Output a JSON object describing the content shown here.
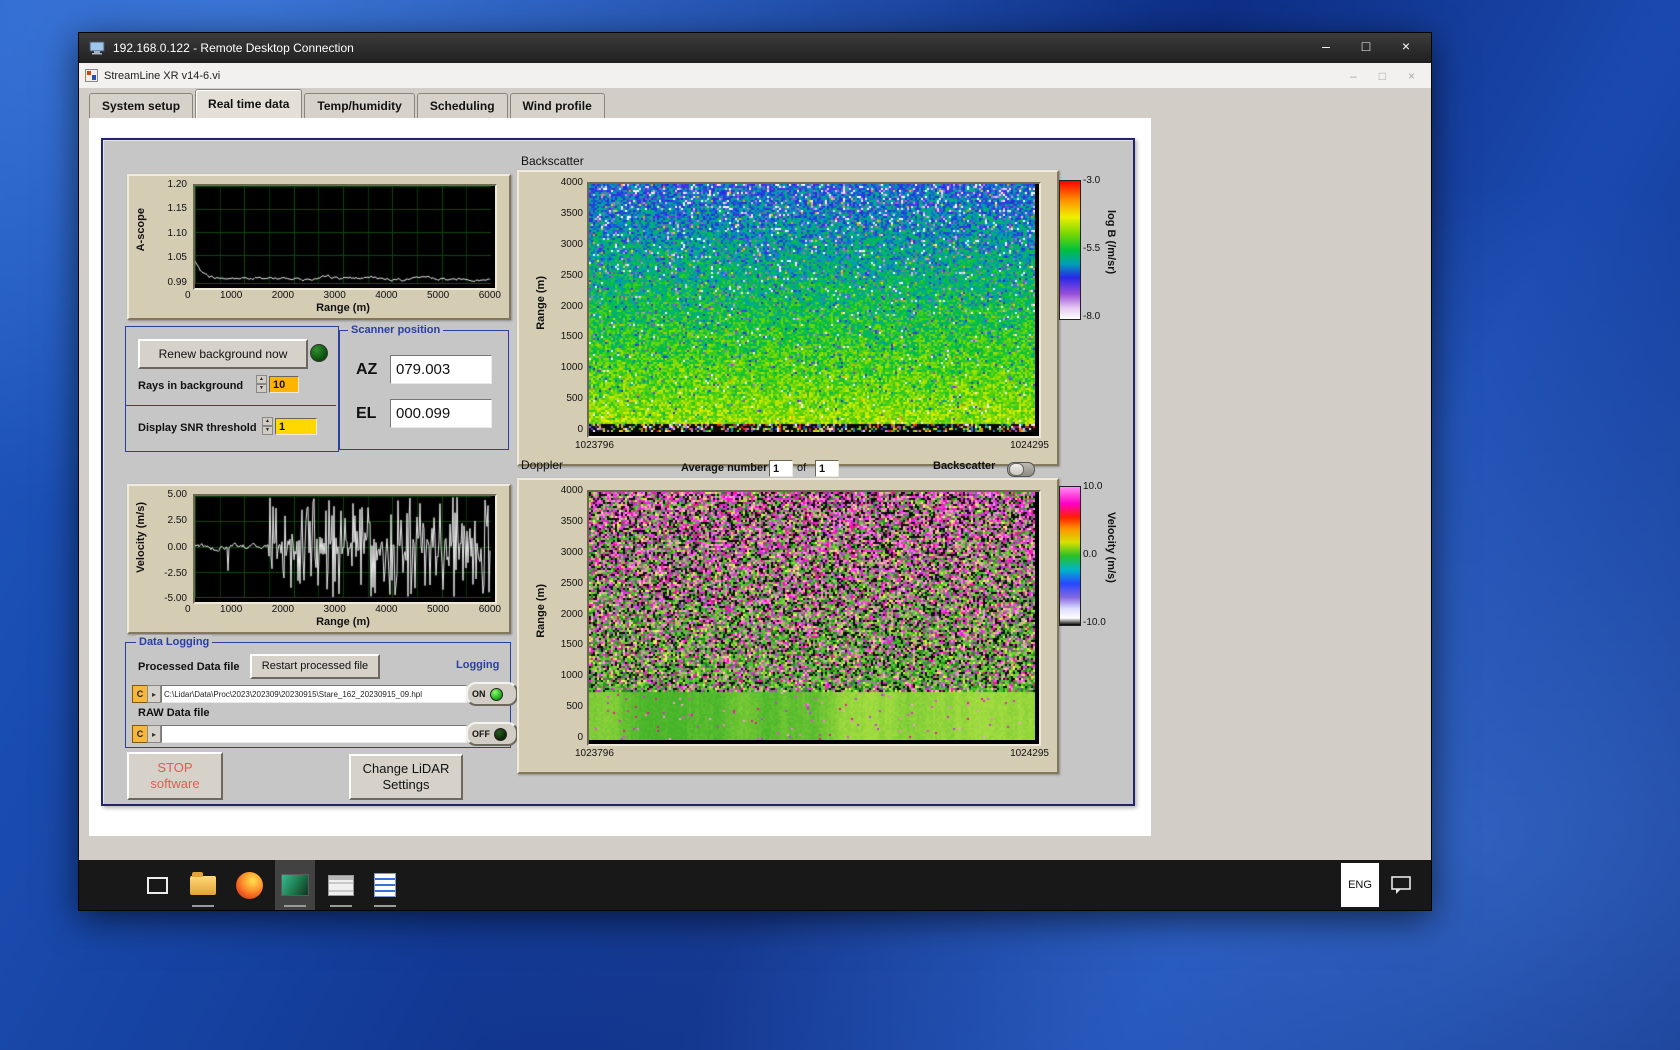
{
  "icons": {
    "minimize": "–",
    "maximize": "□",
    "close": "×",
    "browse": "▸",
    "spin_up": "▲",
    "spin_down": "▼"
  },
  "rdp": {
    "title": "192.168.0.122 - Remote Desktop Connection"
  },
  "app": {
    "title": "StreamLine XR v14-6.vi",
    "tabs": [
      {
        "label": "System setup"
      },
      {
        "label": "Real time data"
      },
      {
        "label": "Temp/humidity"
      },
      {
        "label": "Scheduling"
      },
      {
        "label": "Wind profile"
      }
    ]
  },
  "controls": {
    "renew_button": "Renew background now",
    "rays_label": "Rays in background",
    "rays_value": "10",
    "snr_label": "Display SNR threshold",
    "snr_value": "1"
  },
  "scanner": {
    "title": "Scanner position",
    "az_label": "AZ",
    "az_value": "079.003",
    "el_label": "EL",
    "el_value": "000.099"
  },
  "logging": {
    "title": "Data Logging",
    "processed_label": "Processed Data file",
    "restart_button": "Restart processed file",
    "logging_label": "Logging",
    "drive_badge": "C",
    "processed_path": "C:\\Lidar\\Data\\Proc\\2023\\202309\\20230915\\Stare_162_20230915_09.hpl",
    "on_label": "ON",
    "raw_label": "RAW Data file",
    "raw_path": "",
    "off_label": "OFF"
  },
  "actions": {
    "stop_line1": "STOP",
    "stop_line2": "software",
    "change_line1": "Change LiDAR",
    "change_line2": "Settings",
    "stop_color": "#e05c50"
  },
  "doppler_controls": {
    "avg_label": "Average number",
    "avg_value": "1",
    "of_label": "of",
    "total_value": "1",
    "toggle_label": "Backscatter"
  },
  "section_titles": {
    "backscatter": "Backscatter",
    "doppler": "Doppler"
  },
  "taskbar": {
    "language": "ENG"
  },
  "chart_data": [
    {
      "type": "line",
      "name": "a-scope",
      "ylabel": "A-scope",
      "xlabel": "Range (m)",
      "yticks": [
        "1.20",
        "1.15",
        "1.10",
        "1.05",
        "0.99"
      ],
      "ytick_fracs": [
        0,
        0.238,
        0.476,
        0.714,
        1
      ],
      "xticks": [
        "0",
        "1000",
        "2000",
        "3000",
        "4000",
        "5000",
        "6000"
      ],
      "x_range": [
        0,
        6000
      ],
      "y_range": [
        0.99,
        1.2
      ],
      "bg": "#000000",
      "grid_color": "#0d4a0d",
      "grid_minor": "#063406",
      "line_color": "#e8e8e8",
      "seed": 7,
      "profile": "ascope"
    },
    {
      "type": "line",
      "name": "velocity",
      "ylabel": "Velocity (m/s)",
      "xlabel": "Range (m)",
      "yticks": [
        "5.00",
        "2.50",
        "0.00",
        "-2.50",
        "-5.00"
      ],
      "ytick_fracs": [
        0,
        0.25,
        0.5,
        0.75,
        1
      ],
      "xticks": [
        "0",
        "1000",
        "2000",
        "3000",
        "4000",
        "5000",
        "6000"
      ],
      "x_range": [
        0,
        6000
      ],
      "y_range": [
        -5,
        5
      ],
      "bg": "#000000",
      "grid_color": "#0d4a0d",
      "grid_minor": "#063406",
      "line_color": "#e8e8e8",
      "seed": 11,
      "profile": "velocity"
    },
    {
      "type": "heatmap",
      "name": "backscatter",
      "title": "Backscatter",
      "ylabel": "Range (m)",
      "yticks": [
        "4000",
        "3500",
        "3000",
        "2500",
        "2000",
        "1500",
        "1000",
        "500",
        "0"
      ],
      "x_axis_labels": [
        "1023796",
        "1024295"
      ],
      "y_range": [
        0,
        4000
      ],
      "value_range": [
        -8,
        -3
      ],
      "seed": 23,
      "profile": "backscatter",
      "colorbar": {
        "labels": [
          "-3.0",
          "-5.5",
          "-8.0"
        ],
        "axis_label": "log B (/m/sr)",
        "stops": [
          [
            0,
            "#ffffff"
          ],
          [
            0.08,
            "#e6c8f2"
          ],
          [
            0.18,
            "#9a50d8"
          ],
          [
            0.3,
            "#2828e8"
          ],
          [
            0.4,
            "#00a0b4"
          ],
          [
            0.5,
            "#00c03c"
          ],
          [
            0.62,
            "#7ad800"
          ],
          [
            0.74,
            "#f0f000"
          ],
          [
            0.87,
            "#ff8800"
          ],
          [
            1,
            "#ff0000"
          ]
        ]
      }
    },
    {
      "type": "heatmap",
      "name": "doppler",
      "title": "Doppler",
      "ylabel": "Range (m)",
      "yticks": [
        "4000",
        "3500",
        "3000",
        "2500",
        "2000",
        "1500",
        "1000",
        "500",
        "0"
      ],
      "x_axis_labels": [
        "1023796",
        "1024295"
      ],
      "y_range": [
        0,
        4000
      ],
      "value_range": [
        -10,
        10
      ],
      "seed": 31,
      "profile": "doppler",
      "speckle": {
        "magenta": [
          "#ff3cf0",
          "#ff7ad6",
          "#e22cc6",
          "#ff0a9e",
          "#c438e8",
          "#ff96e4"
        ],
        "green": [
          "#2a9424",
          "#3fbe2a",
          "#63cc2e",
          "#8cd636",
          "#1e7e20",
          "#4fc437"
        ],
        "yellow": [
          "#e8e84c",
          "#ccdf3e",
          "#f2f26a"
        ],
        "dark": "#0c0c0c",
        "base_low": "#46b42a",
        "base_high": "#a2dc40"
      },
      "colorbar": {
        "labels": [
          "10.0",
          "0.0",
          "-10.0"
        ],
        "axis_label": "Velocity (m/s)",
        "stops": [
          [
            0,
            "#000000"
          ],
          [
            0.05,
            "#ffffff"
          ],
          [
            0.12,
            "#dcdcff"
          ],
          [
            0.2,
            "#8468e0"
          ],
          [
            0.3,
            "#2848ff"
          ],
          [
            0.4,
            "#00b4c8"
          ],
          [
            0.5,
            "#28c028"
          ],
          [
            0.6,
            "#d8e000"
          ],
          [
            0.7,
            "#ff9000"
          ],
          [
            0.78,
            "#ff2000"
          ],
          [
            0.88,
            "#ff00c8"
          ],
          [
            1,
            "#ff8cf4"
          ]
        ]
      }
    }
  ]
}
